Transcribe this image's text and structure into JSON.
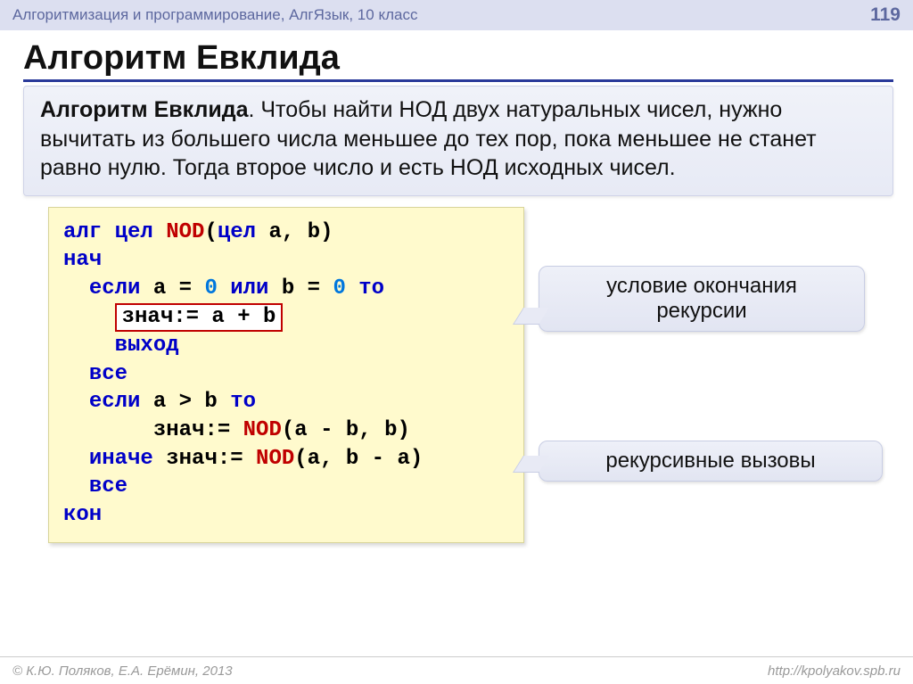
{
  "header": {
    "course": "Алгоритмизация и программирование, АлгЯзык, 10 класс",
    "page": "119"
  },
  "title": "Алгоритм Евклида",
  "definition": {
    "term": "Алгоритм Евклида",
    "text": ". Чтобы найти НОД двух натуральных чисел, нужно вычитать из большего числа меньшее до тех пор, пока меньшее не станет равно нулю. Тогда второе число и есть НОД исходных чисел."
  },
  "code": {
    "kw_alg": "алг",
    "kw_int": "цел",
    "fn_name": "NOD",
    "sig_open": "(",
    "kw_int2": "цел",
    "sig_rest": " a, b)",
    "kw_begin": "нач",
    "kw_if": "если",
    "cond1_a": " a = ",
    "zero1": "0",
    "cond1_or": " или",
    "cond1_b": " b = ",
    "zero2": "0",
    "kw_then": " то",
    "framed": "знач:= a + b",
    "kw_exit": "выход",
    "kw_endif": "все",
    "kw_if2": "если",
    "cond2": " a > b ",
    "kw_then2": "то",
    "assign2_pre": "знач:= ",
    "call2": "NOD",
    "assign2_args": "(a - b, b)",
    "kw_else": "иначе",
    "assign3_pre": " знач:= ",
    "call3": "NOD",
    "assign3_args": "(a, b - a)",
    "kw_endif2": "все",
    "kw_end": "кон"
  },
  "callouts": {
    "end_condition": "условие окончания рекурсии",
    "rec_calls": "рекурсивные вызовы"
  },
  "footer": {
    "author": "© К.Ю. Поляков, Е.А. Ерёмин, 2013",
    "url": "http://kpolyakov.spb.ru"
  }
}
